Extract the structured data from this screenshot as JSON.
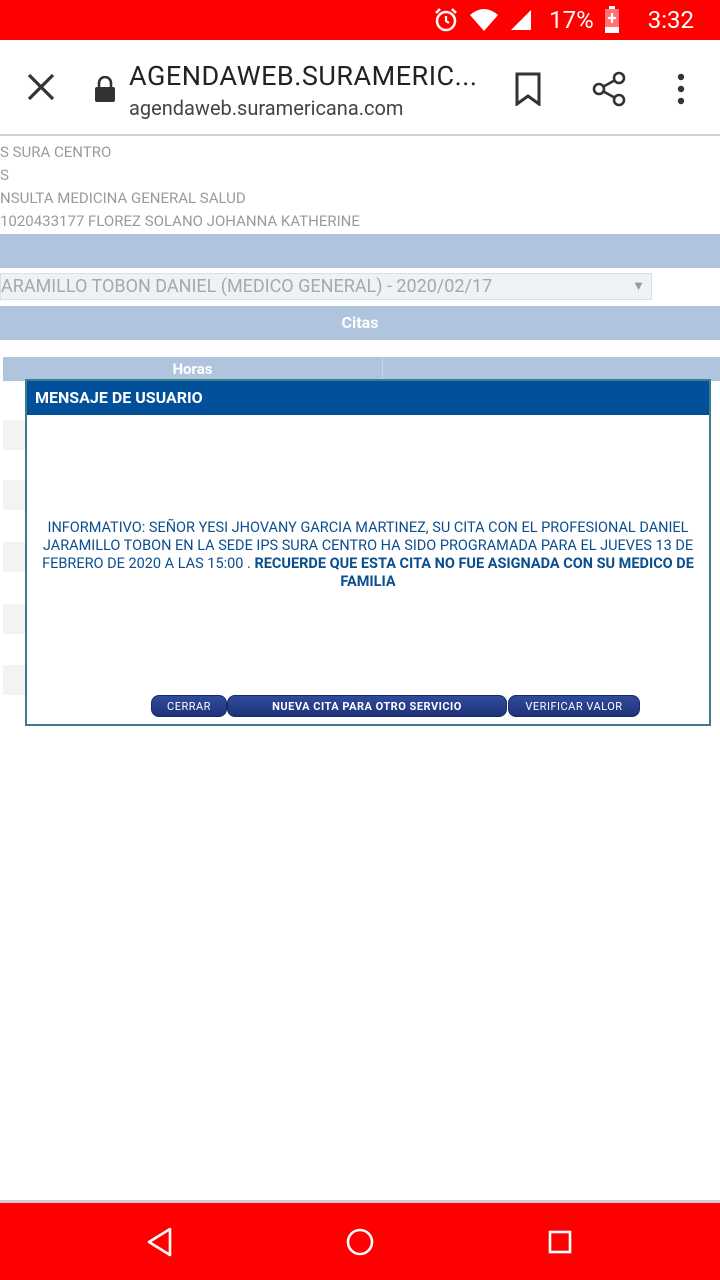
{
  "status_bar": {
    "battery_percent": "17%",
    "time": "3:32",
    "icons": [
      "alarm-icon",
      "wifi-icon",
      "signal-icon",
      "battery-charging-icon"
    ]
  },
  "browser": {
    "title": "AGENDAWEB.SURAMERIC...",
    "url": "agendaweb.suramericana.com",
    "icons": [
      "close-icon",
      "lock-icon",
      "bookmark-icon",
      "share-icon",
      "more-vert-icon"
    ]
  },
  "page": {
    "info_lines": [
      "S SURA CENTRO",
      "S",
      "NSULTA MEDICINA GENERAL SALUD",
      "1020433177 FLOREZ SOLANO JOHANNA KATHERINE"
    ],
    "doctor_select_value": "ARAMILLO TOBON DANIEL (MEDICO GENERAL) - 2020/02/17",
    "citas_label": "Citas",
    "horas_label": "Horas"
  },
  "dialog": {
    "title": "MENSAJE DE USUARIO",
    "message_normal": "INFORMATIVO: SEÑOR YESI JHOVANY GARCIA MARTINEZ, SU CITA CON EL PROFESIONAL DANIEL JARAMILLO TOBON EN LA SEDE IPS SURA CENTRO HA SIDO PROGRAMADA PARA EL JUEVES 13 DE FEBRERO DE 2020 A LAS 15:00 .",
    "message_bold": "RECUERDE QUE ESTA CITA NO FUE ASIGNADA CON SU MEDICO DE FAMILIA",
    "buttons": {
      "close": "CERRAR",
      "new_appointment": "NUEVA CITA PARA OTRO SERVICIO",
      "verify_value": "VERIFICAR VALOR"
    }
  },
  "nav_bar": {
    "icons": [
      "back-icon",
      "home-icon",
      "recents-icon"
    ]
  },
  "colors": {
    "status_bar": "#ff0000",
    "dialog_header": "#02509a",
    "band": "#b0c4de",
    "message_text": "#0b4d8f"
  }
}
